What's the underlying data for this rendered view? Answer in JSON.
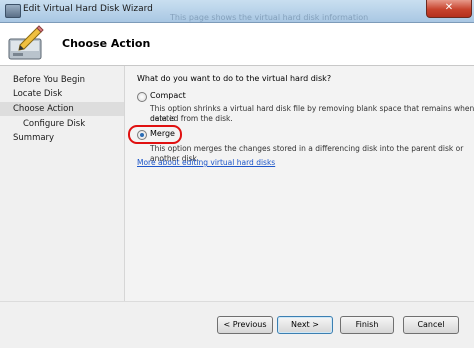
{
  "window": {
    "title": "Edit Virtual Hard Disk Wizard",
    "background_text": "This page shows the virtual hard disk information"
  },
  "header": {
    "heading": "Choose Action"
  },
  "nav": {
    "items": [
      {
        "label": "Before You Begin"
      },
      {
        "label": "Locate Disk"
      },
      {
        "label": "Choose Action"
      },
      {
        "label": "Configure Disk"
      },
      {
        "label": "Summary"
      }
    ]
  },
  "content": {
    "question": "What do you want to do to the virtual hard disk?",
    "options": [
      {
        "label": "Compact",
        "selected": false,
        "desc1": "This option shrinks a virtual hard disk file by removing blank space that remains when data is",
        "desc2": "deleted from the disk."
      },
      {
        "label": "Merge",
        "selected": true,
        "desc1": "This option merges the changes stored in a differencing disk into the parent disk or another disk."
      }
    ],
    "link": "More about editing virtual hard disks"
  },
  "footer": {
    "previous": "< Previous",
    "next": "Next >",
    "finish": "Finish",
    "cancel": "Cancel"
  },
  "colors": {
    "accent": "#1d56c9",
    "highlight": "#e01010"
  },
  "icons": {
    "app": "app-icon",
    "wizard": "disk-pencil-icon",
    "close": "close-icon"
  }
}
